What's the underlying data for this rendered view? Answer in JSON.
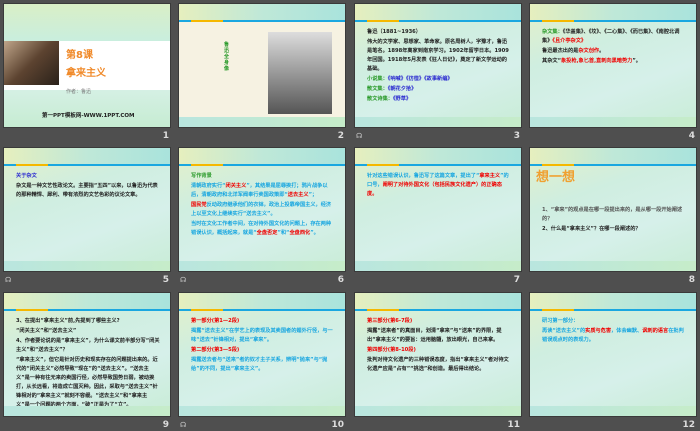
{
  "colors": {
    "black": "#222222",
    "red": "#f00000",
    "green": "#2a9a2a",
    "blue": "#2a2ad0",
    "cyan": "#1aa7e0",
    "orange": "#f08a2a",
    "gray": "#555555"
  },
  "transition_icon": "☊",
  "slides": [
    {
      "number": "1",
      "title_line1": "第8课",
      "title_line2": "拿来主义",
      "author": "作者：鲁迅",
      "footer": "第一PPT模板网-WWW.1PPT.COM"
    },
    {
      "number": "2",
      "caption": "鲁迅全身像"
    },
    {
      "number": "3",
      "transition": true,
      "lines": [
        [
          [
            "鲁迅（1881~1936）",
            "black"
          ]
        ],
        [
          [
            "伟大的文学家、思想家、革命家。原名周树人，字豫才，鲁迅是笔名。1898年离家到南京学习。1902年留学日本。1909年回国。1918年5月发表《狂人日记》，奠定了新文学运动的基础。",
            "black"
          ]
        ],
        [
          [
            "小说集：",
            "green"
          ],
          [
            "《呐喊》《彷徨》《故事新编》",
            "blue"
          ]
        ],
        [
          [
            "散文集：",
            "green"
          ],
          [
            "《朝花夕拾》",
            "blue"
          ]
        ],
        [
          [
            "散文诗集：",
            "green"
          ],
          [
            "《野草》",
            "blue"
          ]
        ]
      ]
    },
    {
      "number": "4",
      "lines": [
        [
          [
            "杂文集：",
            "green"
          ],
          [
            "《华盖集》、《坟》、《二心集》、《而已集》、《南腔北调集》",
            "black"
          ],
          [
            "《且介亭杂文》",
            "red"
          ]
        ],
        [
          [
            "鲁迅最杰出的是",
            "black"
          ],
          [
            "杂文创作",
            "red"
          ],
          [
            "。",
            "black"
          ]
        ],
        [
          [
            "其杂文“",
            "black"
          ],
          [
            "象投枪,象匕首,直刺向黑暗势力",
            "red"
          ],
          [
            "”。",
            "black"
          ]
        ]
      ]
    },
    {
      "number": "5",
      "transition": true,
      "lines": [
        [
          [
            "关于杂文",
            "blue"
          ]
        ],
        [
          [
            "杂文是一种文艺性政论文。主要指“五四”以来，以鲁迅为代表的那种精悍、犀利、带有浓烈的文艺色彩的议论文章。",
            "black"
          ]
        ]
      ]
    },
    {
      "number": "6",
      "transition": true,
      "lines": [
        [
          [
            "写作背景",
            "green"
          ]
        ],
        [
          [
            "清朝政府实行“",
            "cyan"
          ],
          [
            "闭关主义",
            "red"
          ],
          [
            "”，其结果是屈辱挨打；鸦片战争以后，清朝政府和北洋军阀奉行卖国政策即“",
            "cyan"
          ],
          [
            "送去主义",
            "red"
          ],
          [
            "”；",
            "cyan"
          ]
        ],
        [
          [
            "国民党",
            "red"
          ],
          [
            "反动政府继承他们的衣钵，政治上投靠帝国主义，经济上以至文化上继续实行“送去主义”。",
            "cyan"
          ]
        ],
        [
          [
            "当时在文化工作者中间，在对待外国文化的问题上，存在两种错误认识，概括起来，就是“",
            "cyan"
          ],
          [
            "全盘否定",
            "red"
          ],
          [
            "”和“",
            "cyan"
          ],
          [
            "全盘西化",
            "red"
          ],
          [
            "”。",
            "cyan"
          ]
        ]
      ]
    },
    {
      "number": "7",
      "lines": [
        [
          [
            "针对这些错误认识，鲁迅写了这篇文章，提出了“",
            "cyan"
          ],
          [
            "拿来主义",
            "red"
          ],
          [
            "”的口号，",
            "cyan"
          ],
          [
            "阐明了对待外国文化（包括民族文化遗产）的正确态度。",
            "red"
          ]
        ]
      ]
    },
    {
      "number": "8",
      "heading": "想一想",
      "lines": [
        [
          [
            "1、“拿来”的观点是在哪一段提出来的，是从哪一段开始阐述的？",
            "gray"
          ]
        ],
        [
          [
            "2、什么是“拿来主义”？在哪一段阐述的？",
            "black"
          ]
        ]
      ]
    },
    {
      "number": "9",
      "lines": [
        [
          [
            "3、在提出“拿来主义”前,先提到了哪些主义?",
            "black"
          ]
        ],
        [
          [
            "“闭关主义”和“送去主义”",
            "black"
          ]
        ],
        [
          [
            "4、作者要论说的是“拿来主义”，为什么课文前半部分写“闭关主义”和“送去主义”？",
            "black"
          ]
        ],
        [
          [
            "“拿来主义”，但它是针对历史和现实存在的问题提出来的。近代的“闭关主义”必然导致“现在”的“送去主义”。“送去主义”是一种有往无来的卖国行径，必然导致国势日弱，被动挨打，从长远看，将造成亡国灭种。因此，采取与“送去主义”针锋相对的“拿来主义”就刻不容缓。“送去主义”和“拿来主义”是一个问题的两个方面，“破”正是为了“立”。",
            "black"
          ]
        ]
      ]
    },
    {
      "number": "10",
      "transition": true,
      "lines": [
        [
          [
            "第一部分(第1—2段)",
            "red"
          ]
        ],
        [
          [
            "揭露“送去主义”在学艺上的表现及其卖国者的媚外行径，与一味“送去”针锋相对，提出“拿来”。",
            "cyan"
          ]
        ],
        [
          [
            "第二部分(第3—5段)",
            "red"
          ]
        ],
        [
          [
            "揭露送去者与“送来”者的奴才主子关系，辨明“抛来”与“抛给”的不同，提出“拿来主义”。",
            "cyan"
          ]
        ]
      ]
    },
    {
      "number": "11",
      "lines": [
        [
          [
            "第三部分(第6-7段)",
            "red"
          ]
        ],
        [
          [
            "揭露“送来者”的真面目，划清“拿来”与“送来”的界限，提出“拿来主义”的要旨：运用脑髓，放出眼光，自己来拿。",
            "black"
          ]
        ],
        [
          [
            "第四部分(第8-10段)",
            "red"
          ]
        ],
        [
          [
            "批判对待文化遗产的三种错误态度，指出“拿来主义”者对待文化遗产应是“占有”“挑选”和创造。最后得出结论。",
            "black"
          ]
        ]
      ]
    },
    {
      "number": "12",
      "lines": [
        [
          [
            "研习第一部分：",
            "cyan"
          ]
        ],
        [
          [
            "再读“送去主义”的",
            "cyan"
          ],
          [
            "实质与危害",
            "red"
          ],
          [
            "，体会幽默、",
            "cyan"
          ],
          [
            "讽刺的语言",
            "red"
          ],
          [
            "在批判错误观点时的表现力。",
            "cyan"
          ]
        ]
      ]
    }
  ]
}
